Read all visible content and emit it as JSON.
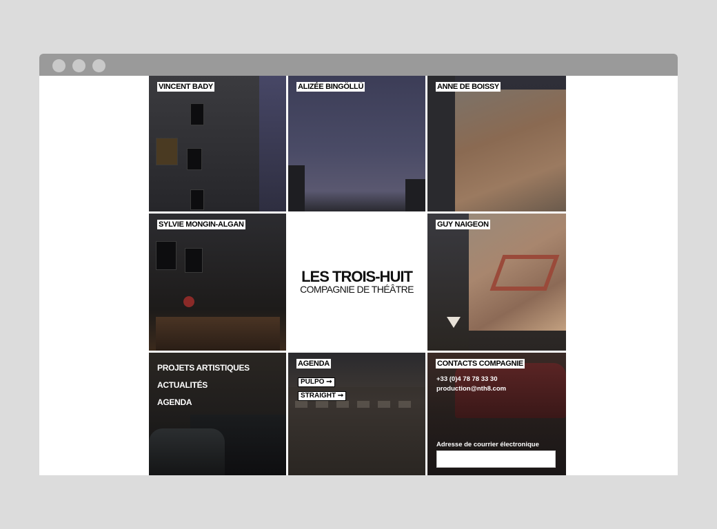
{
  "browser": {
    "window_dots": [
      "close",
      "minimize",
      "maximize"
    ]
  },
  "grid": {
    "people": [
      {
        "name": "VINCENT BADY"
      },
      {
        "name": "ALIZÉE BINGÖLLÜ"
      },
      {
        "name": "ANNE DE BOISSY"
      },
      {
        "name": "SYLVIE MONGIN-ALGAN"
      },
      {
        "name": "GUY NAIGEON"
      }
    ],
    "logo": {
      "title": "LES TROIS-HUIT",
      "subtitle": "COMPAGNIE DE THÉÂTRE"
    },
    "menu": {
      "items": [
        "PROJETS ARTISTIQUES",
        "ACTUALITÉS",
        "AGENDA"
      ]
    },
    "agenda": {
      "heading": "AGENDA",
      "links": [
        "PULPO ➞",
        "STRAIGHT ➞"
      ]
    },
    "contacts": {
      "heading": "CONTACTS COMPAGNIE",
      "phone": "+33 (0)4 78 78 33 30",
      "email": "production@nth8.com",
      "newsletter_label": "Adresse de courrier électronique",
      "newsletter_placeholder": ""
    }
  },
  "colors": {
    "background": "#dcdcdc",
    "titlebar": "#9a9a9a",
    "tag_bg": "#ffffff"
  }
}
